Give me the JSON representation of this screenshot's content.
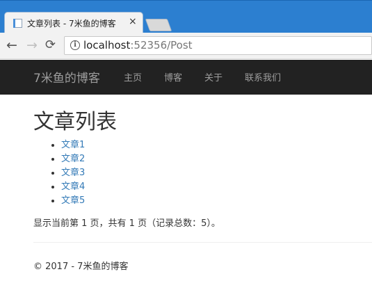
{
  "browser": {
    "tab_title": "文章列表 - 7米鱼的博客",
    "tab_close": "×",
    "url_host": "localhost",
    "url_rest": ":52356/Post",
    "icons": {
      "back": "arrow-left-icon",
      "forward": "arrow-right-icon",
      "reload": "reload-icon",
      "info": "info-icon",
      "favicon": "page-icon",
      "close": "close-icon"
    }
  },
  "navbar": {
    "brand": "7米鱼的博客",
    "links": [
      "主页",
      "博客",
      "关于",
      "联系我们"
    ]
  },
  "main": {
    "title": "文章列表",
    "posts": [
      "文章1",
      "文章2",
      "文章3",
      "文章4",
      "文章5"
    ],
    "pager_info": "显示当前第 1 页，共有 1 页（记录总数：5）。"
  },
  "footer": {
    "text": "© 2017 - 7米鱼的博客"
  },
  "colors": {
    "tabstrip": "#2c7fd0",
    "navbar_bg": "#222222",
    "navbar_text": "#9d9d9d",
    "link": "#337ab7"
  }
}
